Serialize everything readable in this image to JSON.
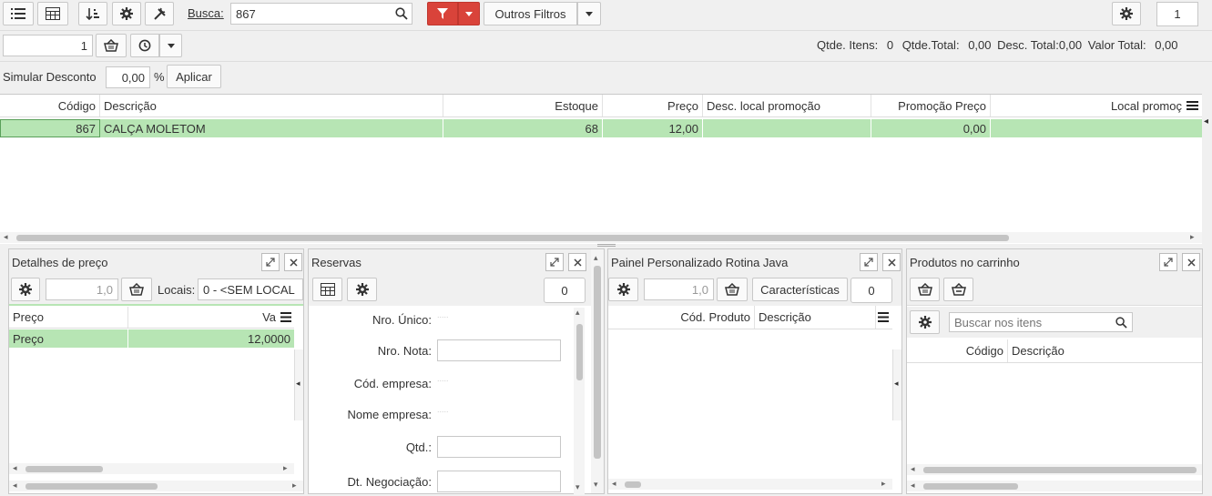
{
  "toolbar": {
    "search_label": "Busca:",
    "search_value": "867",
    "other_filters": "Outros Filtros",
    "page_number": "1"
  },
  "row2": {
    "qty_value": "1",
    "summary": {
      "qtde_itens_label": "Qtde. Itens:",
      "qtde_itens_value": "0",
      "qtde_total_label": "Qtde.Total:",
      "qtde_total_value": "0,00",
      "desc_total_label": "Desc. Total:",
      "desc_total_value": "0,00",
      "valor_total_label": "Valor Total:",
      "valor_total_value": "0,00"
    }
  },
  "discount": {
    "label": "Simular Desconto",
    "value": "0,00",
    "percent": "%",
    "apply": "Aplicar"
  },
  "main_grid": {
    "columns": [
      "Código",
      "Descrição",
      "Estoque",
      "Preço",
      "Desc. local promoção",
      "Promoção Preço",
      "Local promoç"
    ],
    "rows": [
      {
        "codigo": "867",
        "descricao": "CALÇA MOLETOM",
        "estoque": "68",
        "preco": "12,00",
        "desc_local": "",
        "promo_preco": "0,00",
        "local": ""
      }
    ]
  },
  "price_panel": {
    "title": "Detalhes de preço",
    "qty_value": "1,0",
    "locais_label": "Locais:",
    "locais_value": "0 - <SEM LOCAL",
    "columns": [
      "Preço",
      "Va"
    ],
    "rows": [
      {
        "label": "Preço",
        "value": "12,0000"
      }
    ]
  },
  "reservas_panel": {
    "title": "Reservas",
    "counter": "0",
    "fields": [
      {
        "label": "Nro. Único:",
        "value": "....."
      },
      {
        "label": "Nro. Nota:",
        "value": ""
      },
      {
        "label": "Cód. empresa:",
        "value": "....."
      },
      {
        "label": "Nome empresa:",
        "value": "....."
      },
      {
        "label": "Qtd.:",
        "value": ""
      },
      {
        "label": "Dt. Negociação:",
        "value": ""
      }
    ]
  },
  "java_panel": {
    "title": "Painel Personalizado Rotina Java",
    "qty_value": "1,0",
    "caracteristicas": "Características",
    "counter": "0",
    "columns": [
      "Cód. Produto",
      "Descrição"
    ]
  },
  "cart_panel": {
    "title": "Produtos no carrinho",
    "search_placeholder": "Buscar nos itens",
    "columns": [
      "Código",
      "Descrição"
    ]
  },
  "colors": {
    "accent_red": "#d9433a",
    "row_green": "#b7e5b4",
    "grid_line": "#e2e2e2"
  }
}
